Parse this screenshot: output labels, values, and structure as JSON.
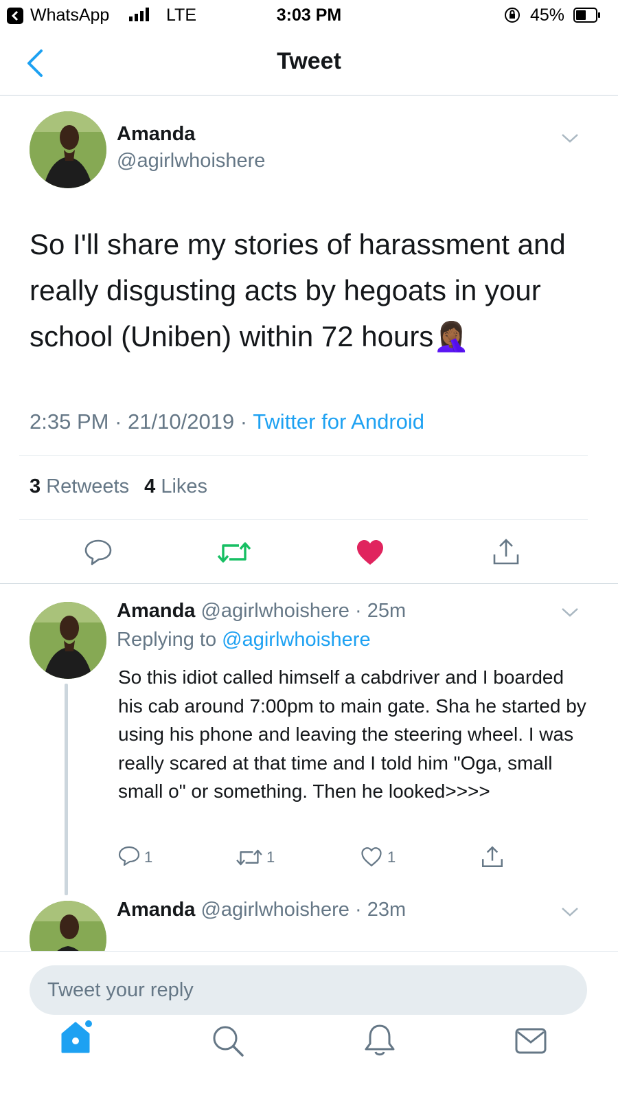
{
  "status_bar": {
    "app": "WhatsApp",
    "network": "LTE",
    "time": "3:03 PM",
    "battery": "45%"
  },
  "header": {
    "title": "Tweet"
  },
  "tweet": {
    "name": "Amanda",
    "handle": "@agirlwhoishere",
    "text": "So I'll share my stories of harassment and really disgusting acts by hegoats in your school (Uniben) within 72 hours",
    "emoji": "🤦🏾‍♀️",
    "time": "2:35 PM",
    "date": "21/10/2019",
    "client": "Twitter for Android",
    "retweets_count": "3",
    "retweets_label": "Retweets",
    "likes_count": "4",
    "likes_label": "Likes",
    "liked": true
  },
  "replies": [
    {
      "name": "Amanda",
      "handle": "@agirlwhoishere",
      "age": "· 25m",
      "replying_label": "Replying to",
      "replying_to": "@agirlwhoishere",
      "text": "So this idiot called himself a cabdriver and I boarded his cab around 7:00pm to main gate. Sha he started by using his phone and leaving the steering wheel. I was really scared at that time and I told him \"Oga, small small o\" or something. Then he looked>>>>",
      "reply_count": "1",
      "retweet_count": "1",
      "like_count": "1"
    },
    {
      "name": "Amanda",
      "handle": "@agirlwhoishere",
      "age": "· 23m"
    }
  ],
  "reply_bar": {
    "placeholder": "Tweet your reply"
  },
  "tab_bar": [
    "home-icon",
    "search-icon",
    "notifications-icon",
    "messages-icon"
  ],
  "colors": {
    "accent": "#1da1f2",
    "retweet": "#17bf63",
    "like": "#e0245e",
    "text": "#14171a",
    "muted": "#657786"
  }
}
